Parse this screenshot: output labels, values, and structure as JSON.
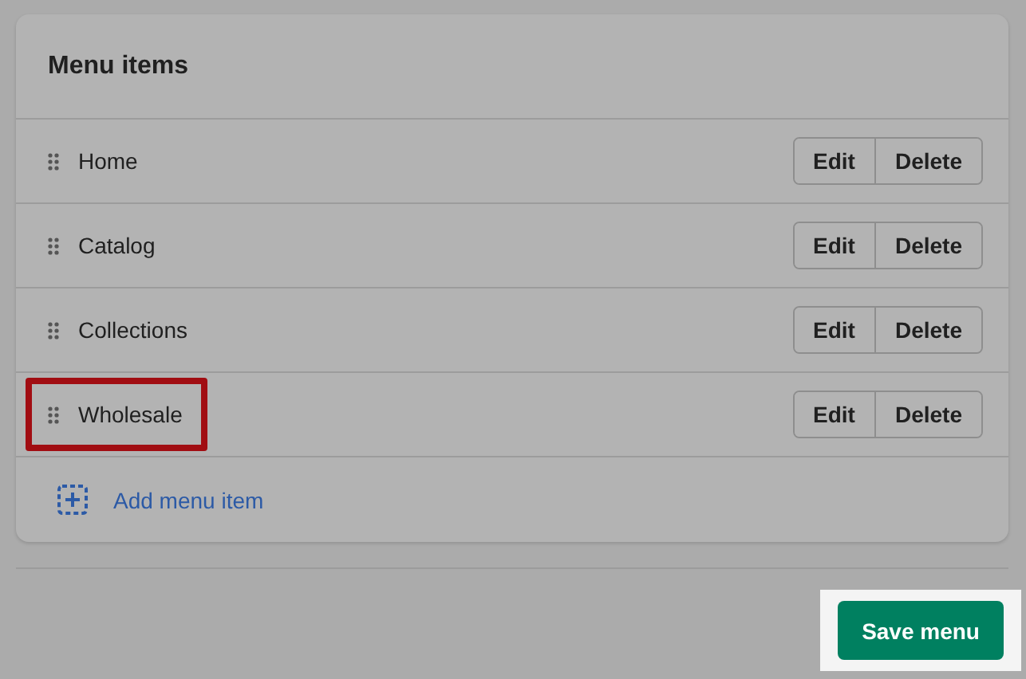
{
  "card": {
    "title": "Menu items"
  },
  "items": [
    {
      "label": "Home",
      "highlighted": false,
      "actions": [
        "Edit",
        "Delete"
      ]
    },
    {
      "label": "Catalog",
      "highlighted": false,
      "actions": [
        "Edit",
        "Delete"
      ]
    },
    {
      "label": "Collections",
      "highlighted": false,
      "actions": [
        "Edit",
        "Delete"
      ]
    },
    {
      "label": "Wholesale",
      "highlighted": true,
      "actions": [
        "Edit",
        "Delete"
      ]
    }
  ],
  "add_item": {
    "label": "Add menu item"
  },
  "save_button": {
    "label": "Save menu",
    "spotlighted": true
  }
}
